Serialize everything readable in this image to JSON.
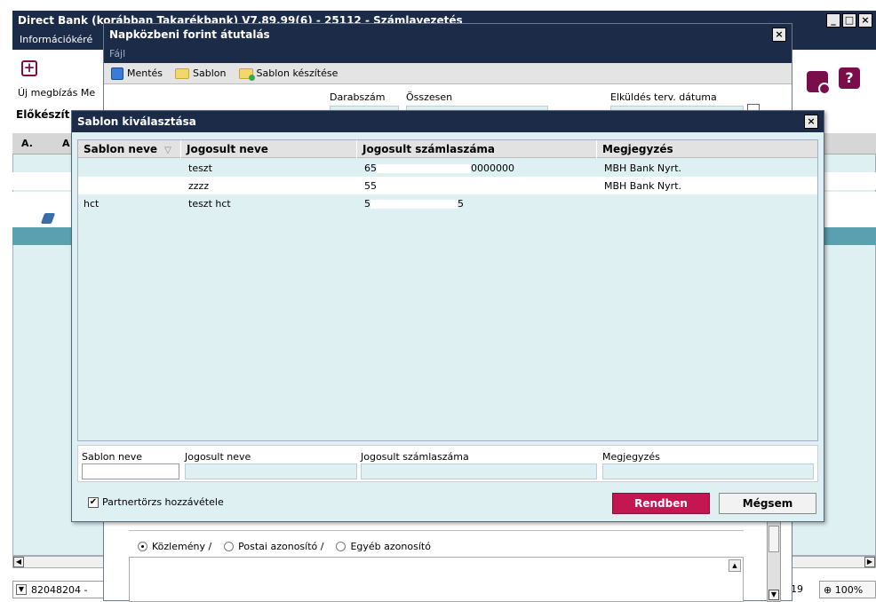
{
  "main": {
    "title": "Direct Bank (korábban Takarékbank)  V7.89.99(6) - 25112 - Számlavezetés",
    "menu": "Információkéré",
    "new_label": "Új megbízás  Me",
    "prep_label": "Előkészít",
    "grid_headers": [
      "A.",
      "A"
    ],
    "account": "82048204 -",
    "status_num": "19",
    "zoom": "100%"
  },
  "mid_dialog": {
    "title": "Napközbeni forint átutalás",
    "menu": "Fájl",
    "toolbar": {
      "save": "Mentés",
      "template": "Sablon",
      "create_template": "Sablon készítése"
    },
    "labels": {
      "count": "Darabszám",
      "total": "Összesen",
      "send_date": "Elküldés terv. dátuma"
    },
    "radios": [
      {
        "label": "Közlemény /",
        "checked": true
      },
      {
        "label": "Postai azonosító /",
        "checked": false
      },
      {
        "label": "Egyéb azonosító",
        "checked": false
      }
    ]
  },
  "template_dialog": {
    "title": "Sablon kiválasztása",
    "columns": [
      "Sablon neve",
      "Jogosult neve",
      "Jogosult számlaszáma",
      "Megjegyzés"
    ],
    "rows": [
      {
        "template_name": "",
        "beneficiary": "teszt",
        "acc_start": "65",
        "acc_end": "0000000",
        "note": "MBH Bank Nyrt."
      },
      {
        "template_name": "",
        "beneficiary": "zzzz",
        "acc_start": "55",
        "acc_end": "",
        "note": "MBH Bank Nyrt."
      },
      {
        "template_name": "hct",
        "beneficiary": "teszt hct",
        "acc_start": "5",
        "acc_end": "5",
        "note": ""
      }
    ],
    "filter_labels": [
      "Sablon neve",
      "Jogosult neve",
      "Jogosult számlaszáma",
      "Megjegyzés"
    ],
    "partner_checkbox": "Partnertörzs hozzávétele",
    "ok": "Rendben",
    "cancel": "Mégsem"
  }
}
